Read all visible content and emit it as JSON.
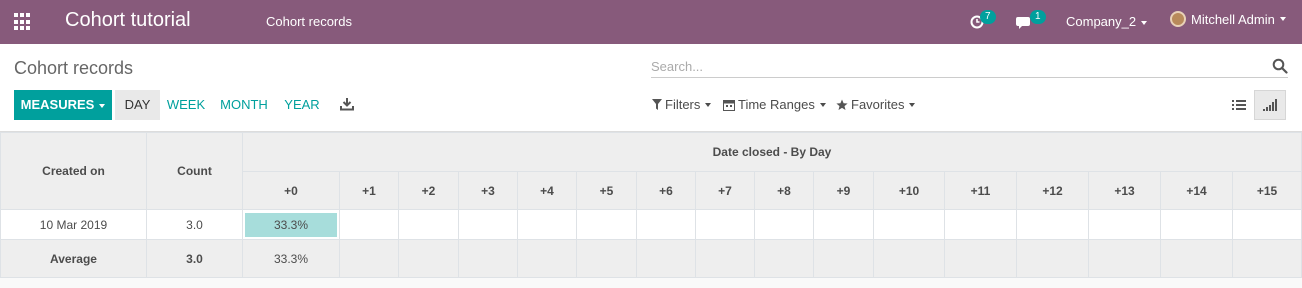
{
  "navbar": {
    "app_title": "Cohort tutorial",
    "menu_item": "Cohort records",
    "activity_count": "7",
    "messages_count": "1",
    "company": "Company_2",
    "user": "Mitchell Admin",
    "background_color": "#875a7b",
    "badge_color": "#00a09d"
  },
  "control_panel": {
    "breadcrumb": "Cohort records",
    "search_placeholder": "Search...",
    "measures_label": "MEASURES",
    "intervals": [
      "DAY",
      "WEEK",
      "MONTH",
      "YEAR"
    ],
    "active_interval": "DAY",
    "filters_label": "Filters",
    "time_ranges_label": "Time Ranges",
    "favorites_label": "Favorites",
    "accent_color": "#00a09d"
  },
  "cohort_table": {
    "row_header": "Created on",
    "count_header": "Count",
    "group_header": "Date closed - By Day",
    "interval_headers": [
      "+0",
      "+1",
      "+2",
      "+3",
      "+4",
      "+5",
      "+6",
      "+7",
      "+8",
      "+9",
      "+10",
      "+11",
      "+12",
      "+13",
      "+14",
      "+15"
    ],
    "rows": [
      {
        "label": "10 Mar 2019",
        "count": "3.0",
        "values": [
          "33.3%"
        ]
      }
    ],
    "average": {
      "label": "Average",
      "count": "3.0",
      "values": [
        "33.3%"
      ]
    },
    "highlight_color": "#a7dddb"
  }
}
